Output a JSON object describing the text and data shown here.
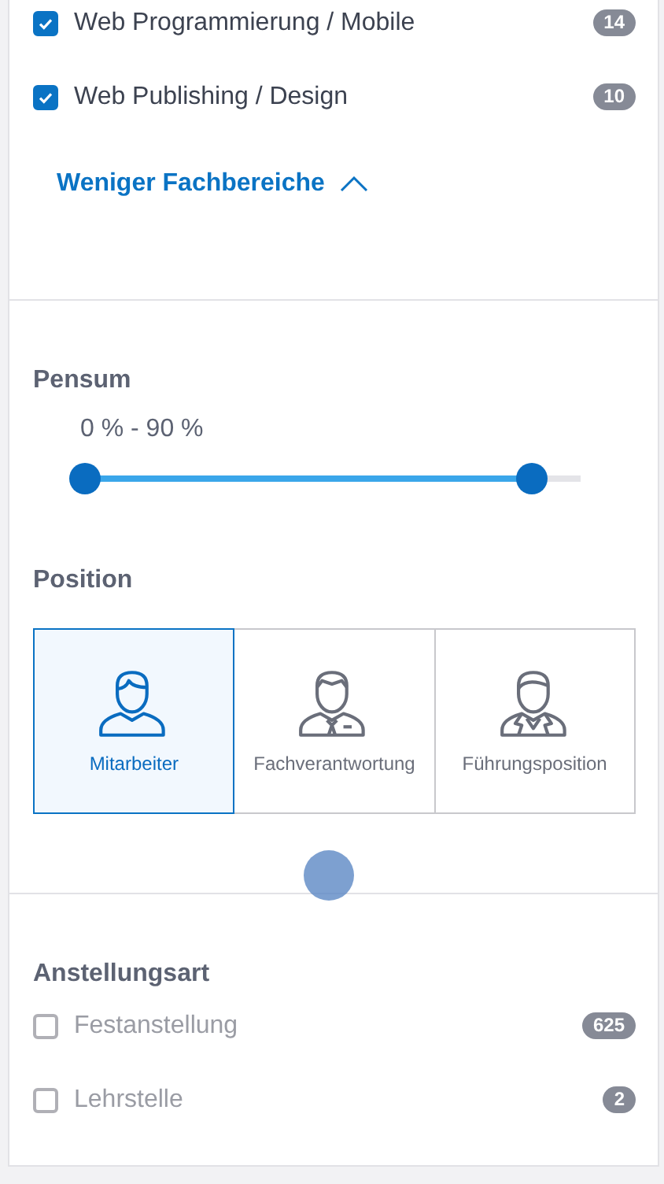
{
  "fachbereiche": [
    {
      "label": "Web Programmierung / Mobile",
      "checked": true,
      "count": "14"
    },
    {
      "label": "Web Publishing / Design",
      "checked": true,
      "count": "10"
    }
  ],
  "less_link": "Weniger Fachbereiche",
  "pensum": {
    "title": "Pensum",
    "reading": "0 % - 90 %",
    "low": {
      "level": 0
    },
    "high": {
      "level": 0.9
    }
  },
  "position": {
    "title": "Position",
    "options": [
      {
        "label": "Mitarbeiter",
        "kind": "employee",
        "selected": true
      },
      {
        "label": "Fachverantwortung",
        "kind": "specialist",
        "selected": false
      },
      {
        "label": "Führungsposition",
        "kind": "manager",
        "selected": false
      }
    ]
  },
  "anstellungsart": {
    "title": "Anstellungsart",
    "items": [
      {
        "label": "Festanstellung",
        "checked": false,
        "count": "625"
      },
      {
        "label": "Lehrstelle",
        "checked": false,
        "count": "2"
      }
    ]
  }
}
